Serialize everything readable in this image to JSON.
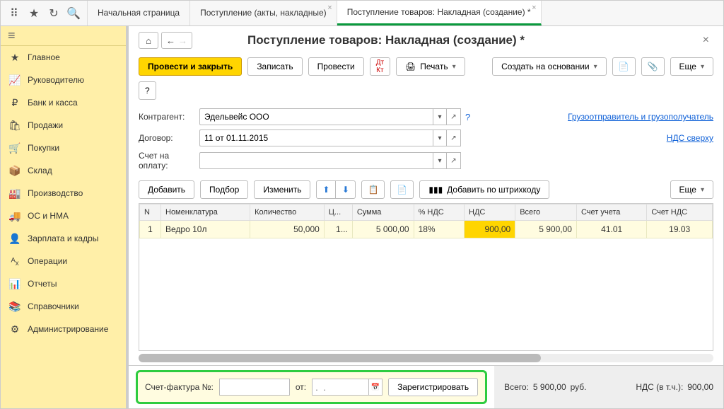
{
  "tabs": {
    "home": "Начальная страница",
    "receipts": "Поступление (акты, накладные)",
    "current": "Поступление товаров: Накладная (создание) *"
  },
  "sidebar": {
    "items": [
      {
        "icon": "★",
        "label": "Главное"
      },
      {
        "icon": "📈",
        "label": "Руководителю"
      },
      {
        "icon": "₽",
        "label": "Банк и касса"
      },
      {
        "icon": "🛍",
        "label": "Продажи"
      },
      {
        "icon": "🛒",
        "label": "Покупки"
      },
      {
        "icon": "📦",
        "label": "Склад"
      },
      {
        "icon": "🏭",
        "label": "Производство"
      },
      {
        "icon": "🚚",
        "label": "ОС и НМА"
      },
      {
        "icon": "👤",
        "label": "Зарплата и кадры"
      },
      {
        "icon": "ᴬₓ",
        "label": "Операции"
      },
      {
        "icon": "📊",
        "label": "Отчеты"
      },
      {
        "icon": "📚",
        "label": "Справочники"
      },
      {
        "icon": "⚙",
        "label": "Администрирование"
      }
    ]
  },
  "page": {
    "title": "Поступление товаров: Накладная (создание) *"
  },
  "toolbar": {
    "post_close": "Провести и закрыть",
    "save": "Записать",
    "post": "Провести",
    "print": "Печать",
    "create_based": "Создать на основании",
    "more": "Еще"
  },
  "form": {
    "contractor_label": "Контрагент:",
    "contractor_value": "Эдельвейс ООО",
    "contract_label": "Договор:",
    "contract_value": "11 от 01.11.2015",
    "invoice_acct_label": "Счет на оплату:",
    "invoice_acct_value": "",
    "shipper_link": "Грузоотправитель и грузополучатель",
    "vat_link": "НДС сверху"
  },
  "table_toolbar": {
    "add": "Добавить",
    "pick": "Подбор",
    "edit": "Изменить",
    "add_barcode": "Добавить по штрихкоду",
    "more": "Еще"
  },
  "table": {
    "headers": [
      "N",
      "Номенклатура",
      "Количество",
      "Ц...",
      "Сумма",
      "% НДС",
      "НДС",
      "Всего",
      "Счет учета",
      "Счет НДС"
    ],
    "row": {
      "n": "1",
      "item": "Ведро 10л",
      "qty": "50,000",
      "price": "1...",
      "sum": "5 000,00",
      "vat_pct": "18%",
      "vat": "900,00",
      "total": "5 900,00",
      "acct": "41.01",
      "vat_acct": "19.03"
    }
  },
  "footer": {
    "invoice_label": "Счет-фактура №:",
    "from_label": "от:",
    "date_placeholder": ".  .",
    "register": "Зарегистрировать",
    "total_label": "Всего:",
    "total_value": "5 900,00",
    "currency": "руб.",
    "vat_label": "НДС (в т.ч.):",
    "vat_value": "900,00"
  }
}
